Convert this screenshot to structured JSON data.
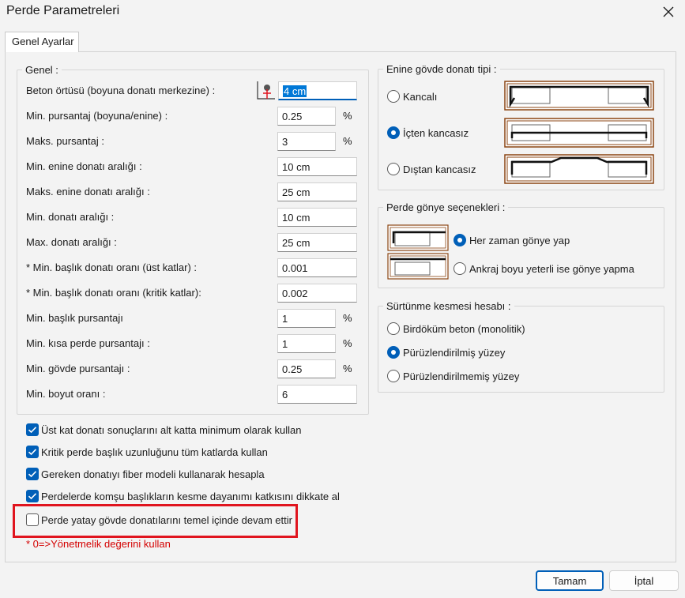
{
  "window": {
    "title": "Perde Parametreleri",
    "close_icon": "close-icon"
  },
  "tabs": [
    {
      "label": "Genel Ayarlar"
    }
  ],
  "genel": {
    "title": "Genel :",
    "rows": [
      {
        "label": "Beton örtüsü (boyuna donatı merkezine) :",
        "value": "4 cm",
        "unit": ""
      },
      {
        "label": "Min. pursantaj (boyuna/enine) :",
        "value": "0.25",
        "unit": "%"
      },
      {
        "label": "Maks. pursantaj :",
        "value": "3",
        "unit": "%"
      },
      {
        "label": "Min. enine donatı aralığı :",
        "value": "10 cm",
        "unit": ""
      },
      {
        "label": "Maks. enine donatı aralığı :",
        "value": "25 cm",
        "unit": ""
      },
      {
        "label": "Min. donatı aralığı :",
        "value": "10 cm",
        "unit": ""
      },
      {
        "label": "Max. donatı aralığı :",
        "value": "25 cm",
        "unit": ""
      },
      {
        "label": "* Min. başlık donatı oranı (üst katlar) :",
        "value": "0.001",
        "unit": ""
      },
      {
        "label": "* Min. başlık donatı oranı (kritik katlar):",
        "value": "0.002",
        "unit": ""
      },
      {
        "label": "Min. başlık pursantajı",
        "value": "1",
        "unit": "%"
      },
      {
        "label": "Min. kısa perde pursantajı :",
        "value": "1",
        "unit": "%"
      },
      {
        "label": "Min. gövde pursantajı :",
        "value": "0.25",
        "unit": "%"
      },
      {
        "label": "Min. boyut oranı :",
        "value": "6",
        "unit": ""
      }
    ]
  },
  "enine": {
    "title": "Enine gövde donatı tipi :",
    "options": [
      {
        "label": "Kancalı",
        "selected": false
      },
      {
        "label": "İçten kancasız",
        "selected": true
      },
      {
        "label": "Dıştan kancasız",
        "selected": false
      }
    ]
  },
  "gonye": {
    "title": "Perde gönye seçenekleri :",
    "options": [
      {
        "label": "Her zaman gönye yap",
        "selected": true
      },
      {
        "label": "Ankraj boyu yeterli ise gönye yapma",
        "selected": false
      }
    ]
  },
  "surtunme": {
    "title": "Sürtünme kesmesi hesabı :",
    "options": [
      {
        "label": "Birdöküm beton (monolitik)",
        "selected": false
      },
      {
        "label": "Pürüzlendirilmiş yüzey",
        "selected": true
      },
      {
        "label": "Pürüzlendirilmemiş yüzey",
        "selected": false
      }
    ]
  },
  "checkboxes": [
    {
      "label": "Üst kat donatı sonuçlarını alt katta minimum olarak kullan",
      "checked": true
    },
    {
      "label": "Kritik perde başlık uzunluğunu tüm katlarda kullan",
      "checked": true
    },
    {
      "label": "Gereken donatıyı fiber modeli kullanarak hesapla",
      "checked": true
    },
    {
      "label": "Perdelerde komşu başlıkların kesme dayanımı katkısını dikkate al",
      "checked": true
    },
    {
      "label": "Perde yatay gövde donatılarını temel içinde devam ettir",
      "checked": false
    }
  ],
  "note": "* 0=>Yönetmelik değerini kullan",
  "buttons": {
    "ok": "Tamam",
    "cancel": "İptal"
  },
  "colors": {
    "accent": "#005fb8",
    "highlight": "#e0141e",
    "note": "#d40000",
    "diagram_frame": "#8b4513"
  }
}
